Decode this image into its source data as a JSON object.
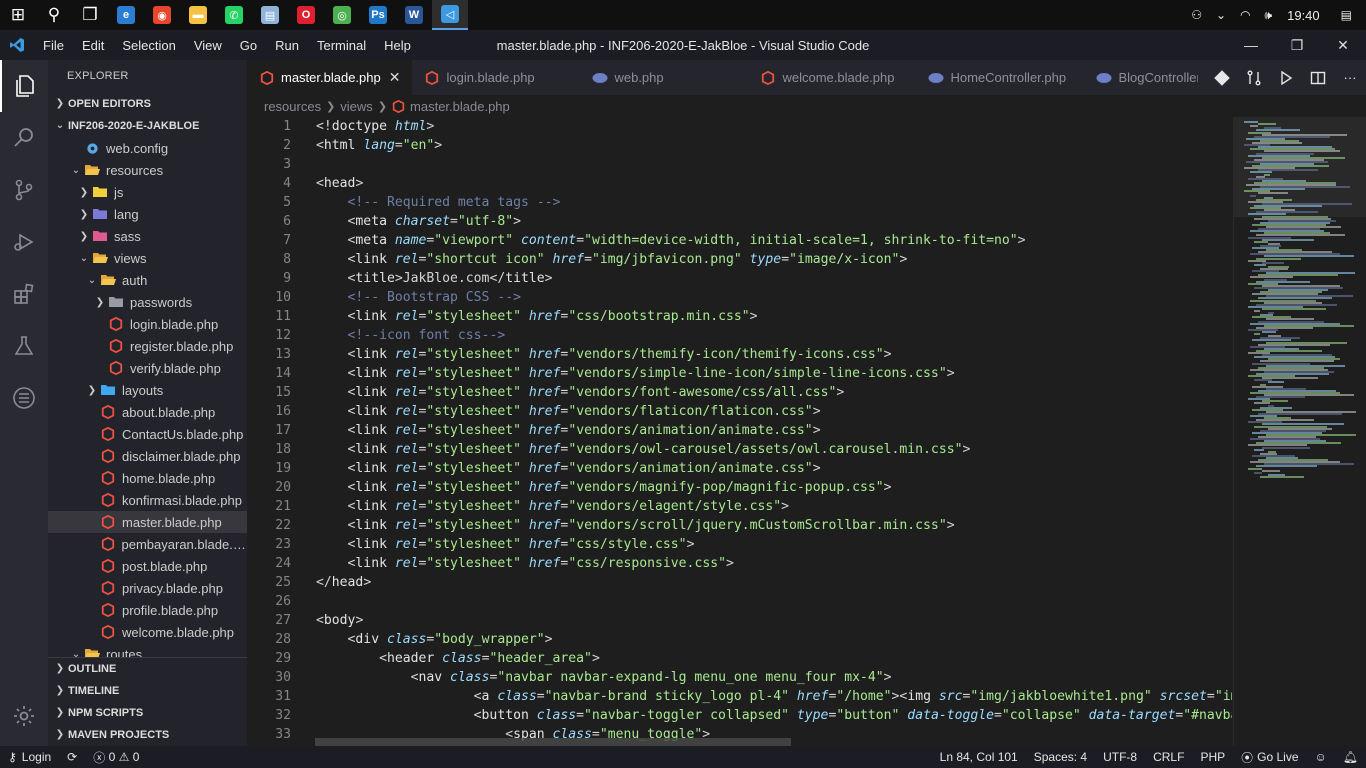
{
  "taskbar": {
    "apps": [
      {
        "name": "windows-start",
        "color": "#ffffff",
        "glyph": "⊞"
      },
      {
        "name": "search",
        "color": "#ffffff",
        "glyph": "⚲"
      },
      {
        "name": "task-view",
        "color": "#ffffff",
        "glyph": "❐"
      },
      {
        "name": "edge",
        "color": "#2b7cd3",
        "glyph": "e"
      },
      {
        "name": "app-red",
        "color": "#e8452e",
        "glyph": "◉"
      },
      {
        "name": "file-explorer",
        "color": "#f5c342",
        "glyph": "▬"
      },
      {
        "name": "whatsapp",
        "color": "#25d366",
        "glyph": "✆"
      },
      {
        "name": "notes",
        "color": "#8fb3d9",
        "glyph": "▤"
      },
      {
        "name": "opera",
        "color": "#e0202e",
        "glyph": "O"
      },
      {
        "name": "chrome",
        "color": "#4caf50",
        "glyph": "◎"
      },
      {
        "name": "photoshop",
        "color": "#1f78c8",
        "glyph": "Ps"
      },
      {
        "name": "word",
        "color": "#2b579a",
        "glyph": "W"
      },
      {
        "name": "vscode",
        "color": "#3c9be0",
        "glyph": "◁"
      }
    ],
    "clock": "19:40"
  },
  "window": {
    "title": "master.blade.php - INF206-2020-E-JakBloe - Visual Studio Code",
    "menu": [
      "File",
      "Edit",
      "Selection",
      "View",
      "Go",
      "Run",
      "Terminal",
      "Help"
    ]
  },
  "sidebar": {
    "title": "EXPLORER",
    "open_editors": "OPEN EDITORS",
    "project": "INF206-2020-E-JAKBLOE",
    "tree": [
      {
        "label": "web.config",
        "depth": 1,
        "kind": "gear",
        "chev": ""
      },
      {
        "label": "resources",
        "depth": 1,
        "kind": "folder-open",
        "chev": "v"
      },
      {
        "label": "js",
        "depth": 2,
        "kind": "folder-js",
        "chev": ">"
      },
      {
        "label": "lang",
        "depth": 2,
        "kind": "folder-lang",
        "chev": ">"
      },
      {
        "label": "sass",
        "depth": 2,
        "kind": "folder-sass",
        "chev": ">"
      },
      {
        "label": "views",
        "depth": 2,
        "kind": "folder-open",
        "chev": "v"
      },
      {
        "label": "auth",
        "depth": 3,
        "kind": "folder-open",
        "chev": "v"
      },
      {
        "label": "passwords",
        "depth": 4,
        "kind": "folder-grey",
        "chev": ">"
      },
      {
        "label": "login.blade.php",
        "depth": 4,
        "kind": "blade",
        "chev": ""
      },
      {
        "label": "register.blade.php",
        "depth": 4,
        "kind": "blade",
        "chev": ""
      },
      {
        "label": "verify.blade.php",
        "depth": 4,
        "kind": "blade",
        "chev": ""
      },
      {
        "label": "layouts",
        "depth": 3,
        "kind": "folder-blue",
        "chev": ">"
      },
      {
        "label": "about.blade.php",
        "depth": 3,
        "kind": "blade",
        "chev": ""
      },
      {
        "label": "ContactUs.blade.php",
        "depth": 3,
        "kind": "blade",
        "chev": ""
      },
      {
        "label": "disclaimer.blade.php",
        "depth": 3,
        "kind": "blade",
        "chev": ""
      },
      {
        "label": "home.blade.php",
        "depth": 3,
        "kind": "blade",
        "chev": ""
      },
      {
        "label": "konfirmasi.blade.php",
        "depth": 3,
        "kind": "blade",
        "chev": ""
      },
      {
        "label": "master.blade.php",
        "depth": 3,
        "kind": "blade",
        "chev": "",
        "selected": true
      },
      {
        "label": "pembayaran.blade.p...",
        "depth": 3,
        "kind": "blade",
        "chev": ""
      },
      {
        "label": "post.blade.php",
        "depth": 3,
        "kind": "blade",
        "chev": ""
      },
      {
        "label": "privacy.blade.php",
        "depth": 3,
        "kind": "blade",
        "chev": ""
      },
      {
        "label": "profile.blade.php",
        "depth": 3,
        "kind": "blade",
        "chev": ""
      },
      {
        "label": "welcome.blade.php",
        "depth": 3,
        "kind": "blade",
        "chev": ""
      },
      {
        "label": "routes",
        "depth": 1,
        "kind": "folder-open",
        "chev": "v"
      }
    ],
    "bottom_sections": [
      "OUTLINE",
      "TIMELINE",
      "NPM SCRIPTS",
      "MAVEN PROJECTS"
    ]
  },
  "tabs": [
    {
      "label": "master.blade.php",
      "kind": "blade",
      "active": true
    },
    {
      "label": "login.blade.php",
      "kind": "blade"
    },
    {
      "label": "web.php",
      "kind": "php"
    },
    {
      "label": "welcome.blade.php",
      "kind": "blade"
    },
    {
      "label": "HomeController.php",
      "kind": "php"
    },
    {
      "label": "BlogController.php",
      "kind": "php"
    }
  ],
  "breadcrumb": [
    "resources",
    "views",
    "master.blade.php"
  ],
  "code_lines": [
    [
      [
        "p",
        "<!"
      ],
      [
        "t",
        "doctype "
      ],
      [
        "a",
        "html"
      ],
      [
        "p",
        ">"
      ]
    ],
    [
      [
        "p",
        "<"
      ],
      [
        "t",
        "html "
      ],
      [
        "a",
        "lang"
      ],
      [
        "p",
        "="
      ],
      [
        "s",
        "\"en\""
      ],
      [
        "p",
        ">"
      ]
    ],
    [],
    [
      [
        "p",
        "<"
      ],
      [
        "t",
        "head"
      ],
      [
        "p",
        ">"
      ]
    ],
    [
      [
        "p",
        "    "
      ],
      [
        "c",
        "<!-- Required meta tags -->"
      ]
    ],
    [
      [
        "p",
        "    <"
      ],
      [
        "t",
        "meta "
      ],
      [
        "a",
        "charset"
      ],
      [
        "p",
        "="
      ],
      [
        "s",
        "\"utf-8\""
      ],
      [
        "p",
        ">"
      ]
    ],
    [
      [
        "p",
        "    <"
      ],
      [
        "t",
        "meta "
      ],
      [
        "a",
        "name"
      ],
      [
        "p",
        "="
      ],
      [
        "s",
        "\"viewport\" "
      ],
      [
        "a",
        "content"
      ],
      [
        "p",
        "="
      ],
      [
        "s",
        "\"width=device-width, initial-scale=1, shrink-to-fit=no\""
      ],
      [
        "p",
        ">"
      ]
    ],
    [
      [
        "p",
        "    <"
      ],
      [
        "t",
        "link "
      ],
      [
        "a",
        "rel"
      ],
      [
        "p",
        "="
      ],
      [
        "s",
        "\"shortcut icon\" "
      ],
      [
        "a",
        "href"
      ],
      [
        "p",
        "="
      ],
      [
        "s",
        "\"img/jbfavicon.png\" "
      ],
      [
        "a",
        "type"
      ],
      [
        "p",
        "="
      ],
      [
        "s",
        "\"image/x-icon\""
      ],
      [
        "p",
        ">"
      ]
    ],
    [
      [
        "p",
        "    <"
      ],
      [
        "t",
        "title"
      ],
      [
        "p",
        ">JakBloe.com</"
      ],
      [
        "t",
        "title"
      ],
      [
        "p",
        ">"
      ]
    ],
    [
      [
        "p",
        "    "
      ],
      [
        "c",
        "<!-- Bootstrap CSS -->"
      ]
    ],
    [
      [
        "p",
        "    <"
      ],
      [
        "t",
        "link "
      ],
      [
        "a",
        "rel"
      ],
      [
        "p",
        "="
      ],
      [
        "s",
        "\"stylesheet\" "
      ],
      [
        "a",
        "href"
      ],
      [
        "p",
        "="
      ],
      [
        "s",
        "\"css/bootstrap.min.css\""
      ],
      [
        "p",
        ">"
      ]
    ],
    [
      [
        "p",
        "    "
      ],
      [
        "c",
        "<!--icon font css-->"
      ]
    ],
    [
      [
        "p",
        "    <"
      ],
      [
        "t",
        "link "
      ],
      [
        "a",
        "rel"
      ],
      [
        "p",
        "="
      ],
      [
        "s",
        "\"stylesheet\" "
      ],
      [
        "a",
        "href"
      ],
      [
        "p",
        "="
      ],
      [
        "s",
        "\"vendors/themify-icon/themify-icons.css\""
      ],
      [
        "p",
        ">"
      ]
    ],
    [
      [
        "p",
        "    <"
      ],
      [
        "t",
        "link "
      ],
      [
        "a",
        "rel"
      ],
      [
        "p",
        "="
      ],
      [
        "s",
        "\"stylesheet\" "
      ],
      [
        "a",
        "href"
      ],
      [
        "p",
        "="
      ],
      [
        "s",
        "\"vendors/simple-line-icon/simple-line-icons.css\""
      ],
      [
        "p",
        ">"
      ]
    ],
    [
      [
        "p",
        "    <"
      ],
      [
        "t",
        "link "
      ],
      [
        "a",
        "rel"
      ],
      [
        "p",
        "="
      ],
      [
        "s",
        "\"stylesheet\" "
      ],
      [
        "a",
        "href"
      ],
      [
        "p",
        "="
      ],
      [
        "s",
        "\"vendors/font-awesome/css/all.css\""
      ],
      [
        "p",
        ">"
      ]
    ],
    [
      [
        "p",
        "    <"
      ],
      [
        "t",
        "link "
      ],
      [
        "a",
        "rel"
      ],
      [
        "p",
        "="
      ],
      [
        "s",
        "\"stylesheet\" "
      ],
      [
        "a",
        "href"
      ],
      [
        "p",
        "="
      ],
      [
        "s",
        "\"vendors/flaticon/flaticon.css\""
      ],
      [
        "p",
        ">"
      ]
    ],
    [
      [
        "p",
        "    <"
      ],
      [
        "t",
        "link "
      ],
      [
        "a",
        "rel"
      ],
      [
        "p",
        "="
      ],
      [
        "s",
        "\"stylesheet\" "
      ],
      [
        "a",
        "href"
      ],
      [
        "p",
        "="
      ],
      [
        "s",
        "\"vendors/animation/animate.css\""
      ],
      [
        "p",
        ">"
      ]
    ],
    [
      [
        "p",
        "    <"
      ],
      [
        "t",
        "link "
      ],
      [
        "a",
        "rel"
      ],
      [
        "p",
        "="
      ],
      [
        "s",
        "\"stylesheet\" "
      ],
      [
        "a",
        "href"
      ],
      [
        "p",
        "="
      ],
      [
        "s",
        "\"vendors/owl-carousel/assets/owl.carousel.min.css\""
      ],
      [
        "p",
        ">"
      ]
    ],
    [
      [
        "p",
        "    <"
      ],
      [
        "t",
        "link "
      ],
      [
        "a",
        "rel"
      ],
      [
        "p",
        "="
      ],
      [
        "s",
        "\"stylesheet\" "
      ],
      [
        "a",
        "href"
      ],
      [
        "p",
        "="
      ],
      [
        "s",
        "\"vendors/animation/animate.css\""
      ],
      [
        "p",
        ">"
      ]
    ],
    [
      [
        "p",
        "    <"
      ],
      [
        "t",
        "link "
      ],
      [
        "a",
        "rel"
      ],
      [
        "p",
        "="
      ],
      [
        "s",
        "\"stylesheet\" "
      ],
      [
        "a",
        "href"
      ],
      [
        "p",
        "="
      ],
      [
        "s",
        "\"vendors/magnify-pop/magnific-popup.css\""
      ],
      [
        "p",
        ">"
      ]
    ],
    [
      [
        "p",
        "    <"
      ],
      [
        "t",
        "link "
      ],
      [
        "a",
        "rel"
      ],
      [
        "p",
        "="
      ],
      [
        "s",
        "\"stylesheet\" "
      ],
      [
        "a",
        "href"
      ],
      [
        "p",
        "="
      ],
      [
        "s",
        "\"vendors/elagent/style.css\""
      ],
      [
        "p",
        ">"
      ]
    ],
    [
      [
        "p",
        "    <"
      ],
      [
        "t",
        "link "
      ],
      [
        "a",
        "rel"
      ],
      [
        "p",
        "="
      ],
      [
        "s",
        "\"stylesheet\" "
      ],
      [
        "a",
        "href"
      ],
      [
        "p",
        "="
      ],
      [
        "s",
        "\"vendors/scroll/jquery.mCustomScrollbar.min.css\""
      ],
      [
        "p",
        ">"
      ]
    ],
    [
      [
        "p",
        "    <"
      ],
      [
        "t",
        "link "
      ],
      [
        "a",
        "rel"
      ],
      [
        "p",
        "="
      ],
      [
        "s",
        "\"stylesheet\" "
      ],
      [
        "a",
        "href"
      ],
      [
        "p",
        "="
      ],
      [
        "s",
        "\"css/style.css\""
      ],
      [
        "p",
        ">"
      ]
    ],
    [
      [
        "p",
        "    <"
      ],
      [
        "t",
        "link "
      ],
      [
        "a",
        "rel"
      ],
      [
        "p",
        "="
      ],
      [
        "s",
        "\"stylesheet\" "
      ],
      [
        "a",
        "href"
      ],
      [
        "p",
        "="
      ],
      [
        "s",
        "\"css/responsive.css\""
      ],
      [
        "p",
        ">"
      ]
    ],
    [
      [
        "p",
        "</"
      ],
      [
        "t",
        "head"
      ],
      [
        "p",
        ">"
      ]
    ],
    [],
    [
      [
        "p",
        "<"
      ],
      [
        "t",
        "body"
      ],
      [
        "p",
        ">"
      ]
    ],
    [
      [
        "p",
        "    <"
      ],
      [
        "t",
        "div "
      ],
      [
        "a",
        "class"
      ],
      [
        "p",
        "="
      ],
      [
        "s",
        "\"body_wrapper\""
      ],
      [
        "p",
        ">"
      ]
    ],
    [
      [
        "p",
        "        <"
      ],
      [
        "t",
        "header "
      ],
      [
        "a",
        "class"
      ],
      [
        "p",
        "="
      ],
      [
        "s",
        "\"header_area\""
      ],
      [
        "p",
        ">"
      ]
    ],
    [
      [
        "p",
        "            <"
      ],
      [
        "t",
        "nav "
      ],
      [
        "a",
        "class"
      ],
      [
        "p",
        "="
      ],
      [
        "s",
        "\"navbar navbar-expand-lg menu_one menu_four mx-4\""
      ],
      [
        "p",
        ">"
      ]
    ],
    [
      [
        "p",
        "                    <"
      ],
      [
        "t",
        "a "
      ],
      [
        "a",
        "class"
      ],
      [
        "p",
        "="
      ],
      [
        "s",
        "\"navbar-brand sticky_logo pl-4\" "
      ],
      [
        "a",
        "href"
      ],
      [
        "p",
        "="
      ],
      [
        "s",
        "\"/home\""
      ],
      [
        "p",
        "><"
      ],
      [
        "t",
        "img "
      ],
      [
        "a",
        "src"
      ],
      [
        "p",
        "="
      ],
      [
        "s",
        "\"img/jakbloewhite1.png\" "
      ],
      [
        "a",
        "srcset"
      ],
      [
        "p",
        "="
      ],
      [
        "s",
        "\"img/"
      ]
    ],
    [
      [
        "p",
        "                    <"
      ],
      [
        "t",
        "button "
      ],
      [
        "a",
        "class"
      ],
      [
        "p",
        "="
      ],
      [
        "s",
        "\"navbar-toggler collapsed\" "
      ],
      [
        "a",
        "type"
      ],
      [
        "p",
        "="
      ],
      [
        "s",
        "\"button\" "
      ],
      [
        "a",
        "data-toggle"
      ],
      [
        "p",
        "="
      ],
      [
        "s",
        "\"collapse\" "
      ],
      [
        "a",
        "data-target"
      ],
      [
        "p",
        "="
      ],
      [
        "s",
        "\"#navbarS"
      ]
    ],
    [
      [
        "p",
        "                        <"
      ],
      [
        "t",
        "span "
      ],
      [
        "a",
        "class"
      ],
      [
        "p",
        "="
      ],
      [
        "s",
        "\"menu_toggle\""
      ],
      [
        "p",
        ">"
      ]
    ]
  ],
  "status": {
    "remote": "Login",
    "sync": "⟳",
    "errors": "0",
    "warnings": "0",
    "position": "Ln 84, Col 101",
    "spaces": "Spaces: 4",
    "encoding": "UTF-8",
    "eol": "CRLF",
    "language": "PHP",
    "live": "Go Live"
  }
}
